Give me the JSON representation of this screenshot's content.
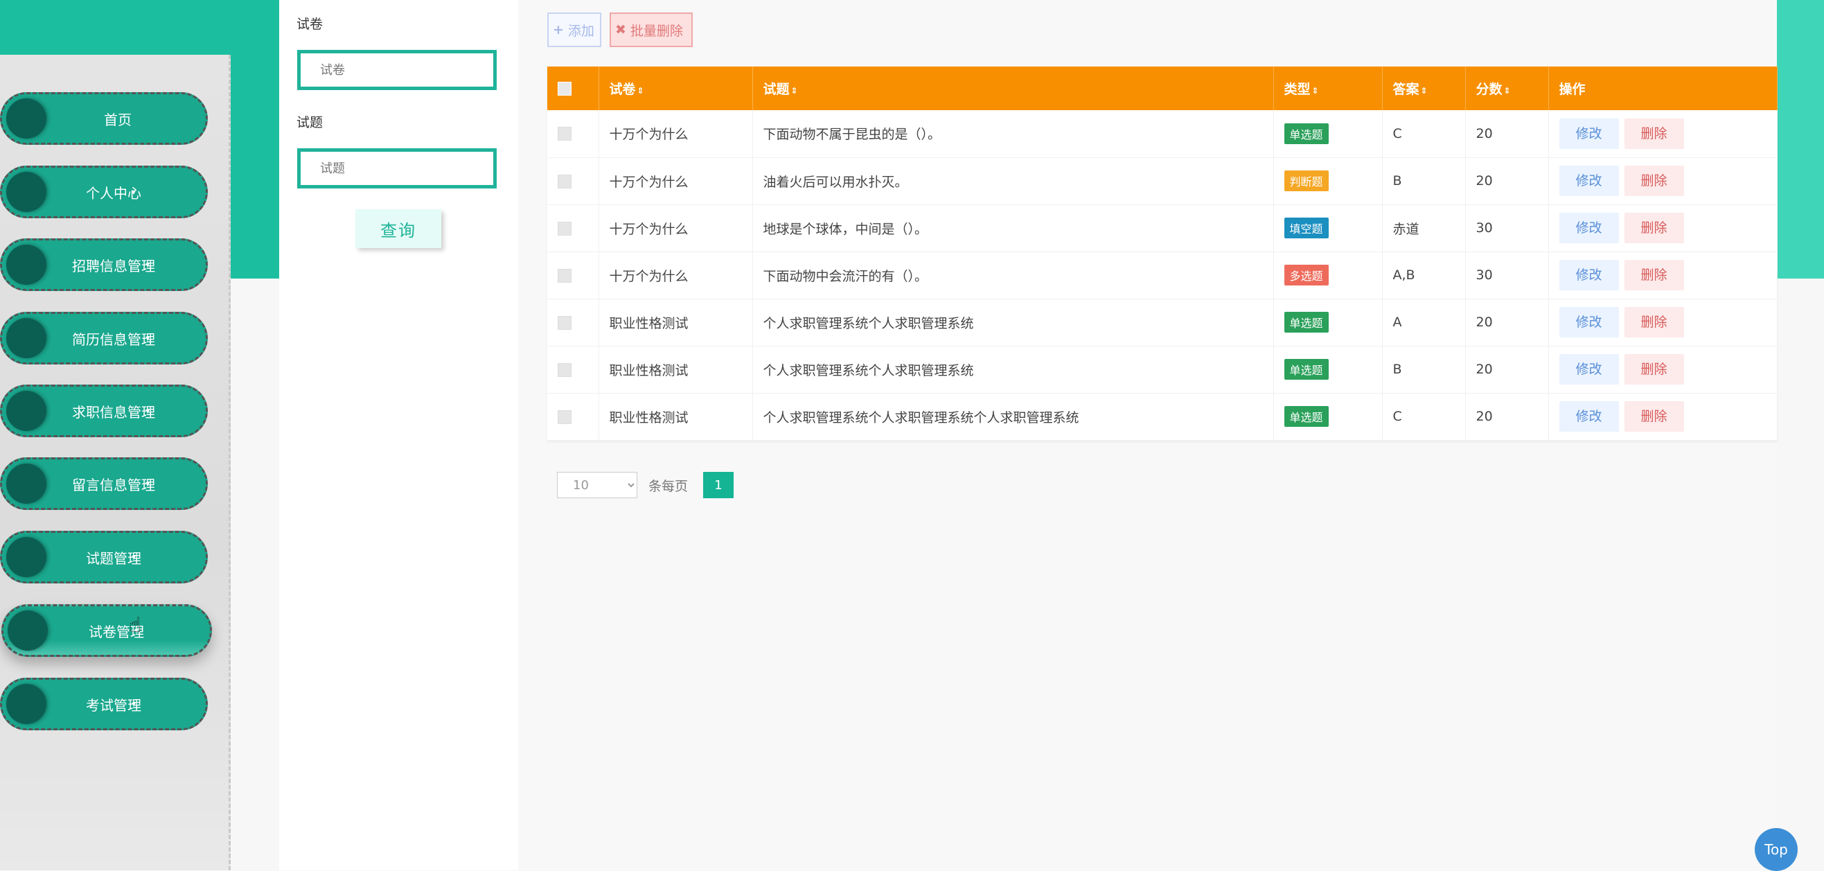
{
  "sidebar": {
    "items": [
      {
        "label": "首页",
        "has_caret": false
      },
      {
        "label": "个人中心",
        "has_caret": true
      },
      {
        "label": "招聘信息管理",
        "has_caret": true
      },
      {
        "label": "简历信息管理",
        "has_caret": true
      },
      {
        "label": "求职信息管理",
        "has_caret": true
      },
      {
        "label": "留言信息管理",
        "has_caret": true
      },
      {
        "label": "试题管理",
        "has_caret": true
      },
      {
        "label": "试卷管理",
        "has_caret": true
      },
      {
        "label": "考试管理",
        "has_caret": true
      }
    ],
    "active_index": 7,
    "caret": "▾"
  },
  "search": {
    "paper_label": "试卷",
    "paper_placeholder": "试卷",
    "question_label": "试题",
    "question_placeholder": "试题",
    "query_button": "查询"
  },
  "toolbar": {
    "add_label": "添加",
    "add_icon": "+",
    "batch_delete_label": "批量删除",
    "batch_delete_icon": "✖"
  },
  "table": {
    "columns": [
      "试卷",
      "试题",
      "类型",
      "答案",
      "分数",
      "操作"
    ],
    "sort_icon": "⇕",
    "rows": [
      {
        "paper": "十万个为什么",
        "question": "下面动物不属于昆虫的是（）。",
        "type": "单选题",
        "type_color": "#2aa05a",
        "answer": "C",
        "score": "20"
      },
      {
        "paper": "十万个为什么",
        "question": "油着火后可以用水扑灭。",
        "type": "判断题",
        "type_color": "#f5a623",
        "answer": "B",
        "score": "20"
      },
      {
        "paper": "十万个为什么",
        "question": "地球是个球体，中间是（）。",
        "type": "填空题",
        "type_color": "#1b8fc0",
        "answer": "赤道",
        "score": "30"
      },
      {
        "paper": "十万个为什么",
        "question": "下面动物中会流汗的有（）。",
        "type": "多选题",
        "type_color": "#ee6b5b",
        "answer": "A,B",
        "score": "30"
      },
      {
        "paper": "职业性格测试",
        "question": "个人求职管理系统个人求职管理系统",
        "type": "单选题",
        "type_color": "#2aa05a",
        "answer": "A",
        "score": "20"
      },
      {
        "paper": "职业性格测试",
        "question": "个人求职管理系统个人求职管理系统",
        "type": "单选题",
        "type_color": "#2aa05a",
        "answer": "B",
        "score": "20"
      },
      {
        "paper": "职业性格测试",
        "question": "个人求职管理系统个人求职管理系统个人求职管理系统",
        "type": "单选题",
        "type_color": "#2aa05a",
        "answer": "C",
        "score": "20"
      }
    ],
    "edit_label": "修改",
    "delete_label": "删除"
  },
  "pagination": {
    "page_size": "10",
    "per_page_label": "条每页",
    "current_page": "1"
  },
  "top_button": "Top",
  "colors": {
    "teal": "#1bbf9f",
    "orange_header": "#f78f00",
    "page_active": "#14b494"
  }
}
